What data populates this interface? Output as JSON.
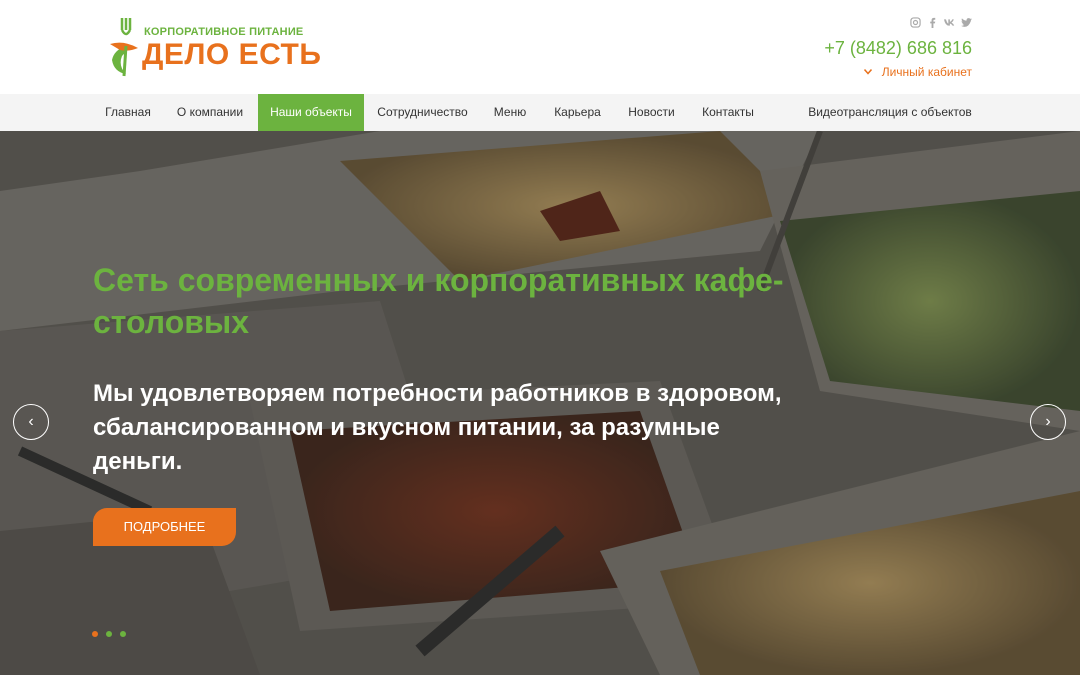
{
  "header": {
    "logo_sub": "КОРПОРАТИВНОЕ ПИТАНИЕ",
    "logo_main": "ДЕЛО ЕСТЬ",
    "phone": "+7 (8482) 686 816",
    "cabinet": "Личный кабинет",
    "socials": [
      "instagram-icon",
      "facebook-icon",
      "vk-icon",
      "twitter-icon"
    ]
  },
  "nav": {
    "items": [
      {
        "label": "Главная"
      },
      {
        "label": "О компании"
      },
      {
        "label": "Наши объекты",
        "active": true
      },
      {
        "label": "Сотрудничество"
      },
      {
        "label": "Меню"
      },
      {
        "label": "Карьера"
      },
      {
        "label": "Новости"
      },
      {
        "label": "Контакты"
      },
      {
        "label": "Видеотрансляция с объектов"
      }
    ]
  },
  "hero": {
    "title": "Сеть современных и корпоративных кафе-столовых",
    "subtitle": "Мы удовлетворяем потребности работников в здоровом, сбалансированном и вкусном питании, за разумные деньги.",
    "button": "ПОДРОБНЕЕ",
    "prev": "‹",
    "next": "›",
    "slides_count": 3,
    "active_slide": 1
  },
  "colors": {
    "brand_green": "#6cb33f",
    "brand_orange": "#e8711d",
    "nav_bg": "#f4f4f4"
  }
}
